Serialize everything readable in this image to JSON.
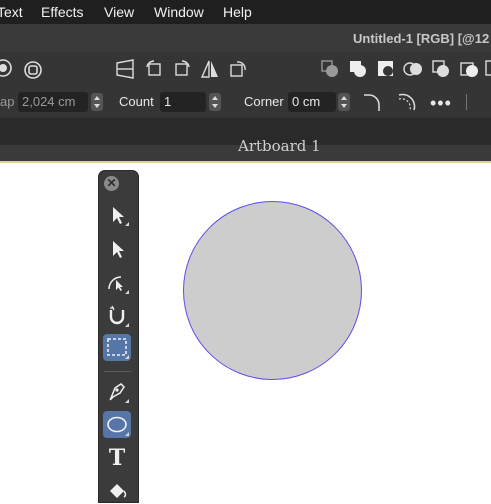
{
  "menubar": {
    "items": [
      {
        "label": "Text",
        "id": "text"
      },
      {
        "label": "Effects",
        "id": "effects"
      },
      {
        "label": "View",
        "id": "view"
      },
      {
        "label": "Window",
        "id": "window"
      },
      {
        "label": "Help",
        "id": "help"
      }
    ]
  },
  "window": {
    "title": "Untitled-1 [RGB] [@12"
  },
  "context_toolbar": {
    "gap_label": "ap",
    "gap_value": "2,024 cm",
    "count_label": "Count",
    "count_value": "1",
    "corner_label": "Corner",
    "corner_value": "0 cm",
    "more_label": "•••"
  },
  "artboard": {
    "title": "Artboard 1",
    "circle_fill": "#cdcdcd",
    "circle_stroke": "#5a50e6"
  },
  "tools": {
    "close_label": "✕",
    "text_tool_glyph": "T",
    "active_color": "#5776a8"
  }
}
